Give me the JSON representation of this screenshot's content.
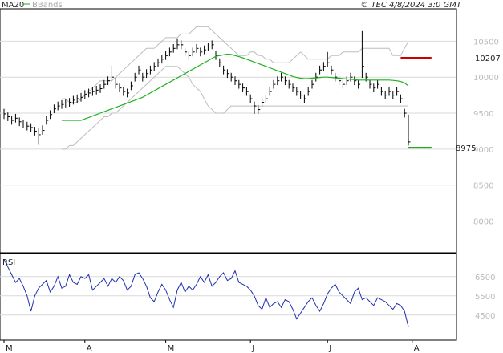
{
  "header": {
    "ma_legend": "MA20",
    "bb_legend": "BBands",
    "copyright": "© TEC 4/8/2024 3:0 GMT"
  },
  "colors": {
    "price": "#000000",
    "ma": "#1fb21f",
    "bands": "#bdbdbd",
    "rsi": "#1f2fb0",
    "resistance": "#cc0000",
    "support": "#009900",
    "grid": "#d9d9d9"
  },
  "chart_data": [
    {
      "type": "line",
      "name": "price",
      "y_ticks": [
        "10500",
        "10000",
        "9500",
        "9000",
        "8500",
        "8000"
      ],
      "y_tick_values": [
        10500,
        10000,
        9500,
        9000,
        8500,
        8000
      ],
      "ylim": [
        7560,
        10950
      ],
      "x_labels": [
        {
          "label": "M",
          "day": 0
        },
        {
          "label": "A",
          "day": 21
        },
        {
          "label": "M",
          "day": 42
        },
        {
          "label": "J",
          "day": 64
        },
        {
          "label": "J",
          "day": 84
        },
        {
          "label": "A",
          "day": 106
        }
      ],
      "close": [
        9490,
        9450,
        9400,
        9430,
        9380,
        9350,
        9320,
        9300,
        9250,
        9200,
        9260,
        9400,
        9480,
        9560,
        9600,
        9620,
        9640,
        9650,
        9680,
        9700,
        9720,
        9760,
        9780,
        9800,
        9820,
        9840,
        9900,
        9950,
        10000,
        9900,
        9850,
        9800,
        9780,
        9880,
        10000,
        10100,
        10000,
        10050,
        10100,
        10150,
        10200,
        10250,
        10300,
        10350,
        10400,
        10450,
        10450,
        10350,
        10300,
        10350,
        10400,
        10350,
        10380,
        10420,
        10450,
        10300,
        10200,
        10100,
        10050,
        10000,
        9950,
        9900,
        9850,
        9800,
        9700,
        9600,
        9550,
        9650,
        9700,
        9800,
        9900,
        9950,
        10000,
        9950,
        9900,
        9850,
        9800,
        9750,
        9700,
        9800,
        9900,
        10000,
        10100,
        10150,
        10200,
        10100,
        10000,
        9950,
        9900,
        9950,
        10000,
        9950,
        9900,
        10150,
        10000,
        9900,
        9850,
        9900,
        9800,
        9750,
        9800,
        9750,
        9800,
        9700,
        9500,
        9100
      ],
      "high": [
        9560,
        9510,
        9460,
        9490,
        9440,
        9410,
        9380,
        9360,
        9310,
        9290,
        9330,
        9460,
        9540,
        9620,
        9660,
        9680,
        9700,
        9710,
        9740,
        9760,
        9780,
        9820,
        9840,
        9860,
        9880,
        9900,
        9960,
        10010,
        10160,
        9990,
        9910,
        9860,
        9840,
        9940,
        10060,
        10160,
        10060,
        10110,
        10160,
        10210,
        10260,
        10310,
        10360,
        10410,
        10460,
        10540,
        10510,
        10410,
        10360,
        10410,
        10460,
        10410,
        10440,
        10480,
        10510,
        10360,
        10260,
        10160,
        10110,
        10060,
        10010,
        9960,
        9910,
        9860,
        9760,
        9660,
        9610,
        9710,
        9760,
        9860,
        9960,
        10010,
        10060,
        10010,
        9960,
        9910,
        9860,
        9810,
        9760,
        9860,
        9960,
        10060,
        10160,
        10210,
        10350,
        10160,
        10060,
        10010,
        9960,
        10010,
        10060,
        10010,
        9960,
        10640,
        10060,
        9960,
        9910,
        9960,
        9860,
        9810,
        9860,
        9810,
        9860,
        9760,
        9560,
        9480
      ],
      "low": [
        9420,
        9390,
        9340,
        9370,
        9320,
        9290,
        9260,
        9240,
        9190,
        9060,
        9200,
        9340,
        9420,
        9500,
        9540,
        9560,
        9580,
        9590,
        9620,
        9640,
        9660,
        9700,
        9720,
        9740,
        9760,
        9780,
        9840,
        9890,
        9940,
        9840,
        9790,
        9740,
        9720,
        9820,
        9940,
        10040,
        9940,
        9990,
        10040,
        10090,
        10140,
        10190,
        10240,
        10290,
        10340,
        10390,
        10390,
        10290,
        10240,
        10290,
        10340,
        10290,
        10320,
        10360,
        10390,
        10240,
        10140,
        10040,
        9990,
        9940,
        9890,
        9840,
        9790,
        9740,
        9640,
        9490,
        9490,
        9590,
        9640,
        9740,
        9840,
        9890,
        9940,
        9890,
        9840,
        9790,
        9740,
        9690,
        9640,
        9740,
        9840,
        9940,
        10040,
        10090,
        10140,
        10040,
        9940,
        9890,
        9840,
        9890,
        9940,
        9890,
        9840,
        9990,
        9940,
        9840,
        9790,
        9840,
        9740,
        9690,
        9740,
        9690,
        9740,
        9640,
        9440,
        9050
      ],
      "ma20": [
        9400,
        9400,
        9400,
        9400,
        9400,
        9400,
        9420,
        9440,
        9460,
        9480,
        9500,
        9520,
        9540,
        9560,
        9580,
        9600,
        9620,
        9640,
        9660,
        9680,
        9700,
        9720,
        9750,
        9780,
        9810,
        9840,
        9870,
        9900,
        9930,
        9960,
        9990,
        10020,
        10050,
        10080,
        10110,
        10140,
        10170,
        10200,
        10230,
        10260,
        10290,
        10300,
        10310,
        10320,
        10315,
        10300,
        10285,
        10270,
        10250,
        10230,
        10210,
        10190,
        10170,
        10150,
        10130,
        10110,
        10090,
        10070,
        10050,
        10030,
        10010,
        9995,
        9985,
        9980,
        9980,
        9985,
        9990,
        9995,
        10000,
        10000,
        9995,
        9990,
        9985,
        9980,
        9975,
        9970,
        9965,
        9960,
        9960,
        9960,
        9960,
        9960,
        9960,
        9960,
        9960,
        9960,
        9955,
        9950,
        9940,
        9920,
        9880
      ],
      "bb_upper": [
        9700,
        9700,
        9650,
        9650,
        9650,
        9700,
        9750,
        9800,
        9850,
        9900,
        9950,
        9950,
        9950,
        9950,
        10000,
        10050,
        10100,
        10150,
        10200,
        10250,
        10300,
        10350,
        10400,
        10400,
        10400,
        10450,
        10500,
        10550,
        10550,
        10550,
        10550,
        10600,
        10600,
        10600,
        10650,
        10700,
        10700,
        10700,
        10700,
        10650,
        10600,
        10550,
        10500,
        10450,
        10400,
        10350,
        10300,
        10300,
        10300,
        10350,
        10350,
        10300,
        10300,
        10250,
        10250,
        10200,
        10200,
        10200,
        10200,
        10200,
        10250,
        10300,
        10350,
        10300,
        10250,
        10250,
        10250,
        10250,
        10250,
        10250,
        10300,
        10300,
        10300,
        10350,
        10350,
        10350,
        10350,
        10350,
        10400,
        10400,
        10400,
        10400,
        10400,
        10400,
        10400,
        10400,
        10300,
        10300,
        10300,
        10400,
        10500
      ],
      "bb_lower": [
        9000,
        9000,
        9050,
        9050,
        9100,
        9150,
        9200,
        9250,
        9300,
        9350,
        9400,
        9450,
        9450,
        9500,
        9500,
        9550,
        9600,
        9650,
        9700,
        9750,
        9800,
        9850,
        9900,
        9950,
        10000,
        10050,
        10100,
        10150,
        10150,
        10150,
        10150,
        10100,
        10050,
        10000,
        9900,
        9850,
        9800,
        9700,
        9600,
        9550,
        9500,
        9500,
        9500,
        9550,
        9600,
        9600,
        9600,
        9600,
        9600,
        9600,
        9600,
        9600,
        9600,
        9600,
        9600,
        9600,
        9600,
        9600,
        9600,
        9600,
        9600,
        9600,
        9600,
        9600,
        9600,
        9600,
        9600,
        9600,
        9600,
        9600,
        9600,
        9600,
        9600,
        9600,
        9600,
        9600,
        9600,
        9600,
        9600,
        9600,
        9600,
        9600,
        9600,
        9600,
        9600,
        9600,
        9600,
        9600,
        9600,
        9600,
        9600
      ],
      "ma_start_day": 15,
      "resistance": {
        "label": "10207",
        "value": 10270,
        "from_day": 103,
        "to_day": 111
      },
      "support": {
        "label": "8975",
        "value": 9020,
        "from_day": 105,
        "to_day": 111
      }
    },
    {
      "type": "line",
      "name": "RSI",
      "title": "RSI",
      "y_ticks": [
        "6500",
        "5500",
        "4500"
      ],
      "y_tick_values": [
        65,
        55,
        45
      ],
      "ylim": [
        32,
        77
      ],
      "values": [
        74,
        70,
        66,
        62,
        64,
        60,
        55,
        47,
        55,
        59,
        61,
        63,
        57,
        60,
        65,
        59,
        60,
        66,
        62,
        61,
        65,
        64,
        66,
        58,
        60,
        62,
        64,
        60,
        64,
        62,
        65,
        63,
        58,
        60,
        66,
        67,
        64,
        60,
        54,
        52,
        57,
        61,
        58,
        53,
        49,
        58,
        62,
        57,
        60,
        58,
        61,
        65,
        62,
        66,
        60,
        62,
        65,
        67,
        63,
        64,
        68,
        62,
        61,
        60,
        58,
        55,
        50,
        48,
        54,
        49,
        51,
        52,
        49,
        53,
        52,
        48,
        43,
        46,
        49,
        52,
        54,
        50,
        47,
        51,
        56,
        59,
        61,
        57,
        55,
        53,
        51,
        57,
        59,
        53,
        54,
        52,
        50,
        54,
        53,
        52,
        50,
        48,
        51,
        50,
        47,
        39
      ]
    }
  ]
}
